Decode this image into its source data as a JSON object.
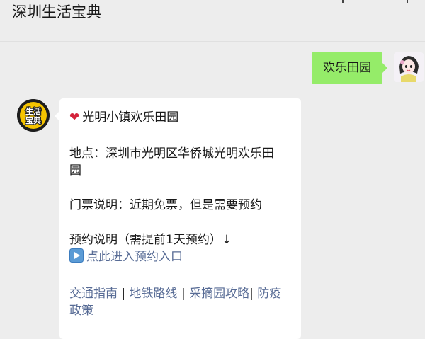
{
  "chat": {
    "title": "深圳生活宝典"
  },
  "messages": {
    "sent": {
      "text": "欢乐田园"
    },
    "received": {
      "heading": "光明小镇欢乐田园",
      "location_line1": "地点：深圳市光明区华侨城光明欢乐田",
      "location_line2": "园",
      "ticket": "门票说明：近期免票，但是需要预约",
      "booking": "预约说明（需提前1天预约）↓",
      "booking_link": "点此进入预约入口",
      "links": {
        "traffic": "交通指南",
        "sep1": " | ",
        "metro": "地铁路线",
        "sep2": " | ",
        "picking": "采摘园攻略",
        "sep3": "| ",
        "epidemic_line1": "防疫",
        "epidemic_line2": "政策"
      }
    }
  },
  "bot_avatar": {
    "text_top": "生活",
    "text_bottom": "宝典"
  },
  "colors": {
    "sent_bubble": "#95ec69",
    "link": "#576b95",
    "heart": "#d4243b",
    "avatar_yellow": "#f5c400"
  },
  "icons": [
    "heart-icon",
    "play-button-icon",
    "more-menu-icon"
  ]
}
